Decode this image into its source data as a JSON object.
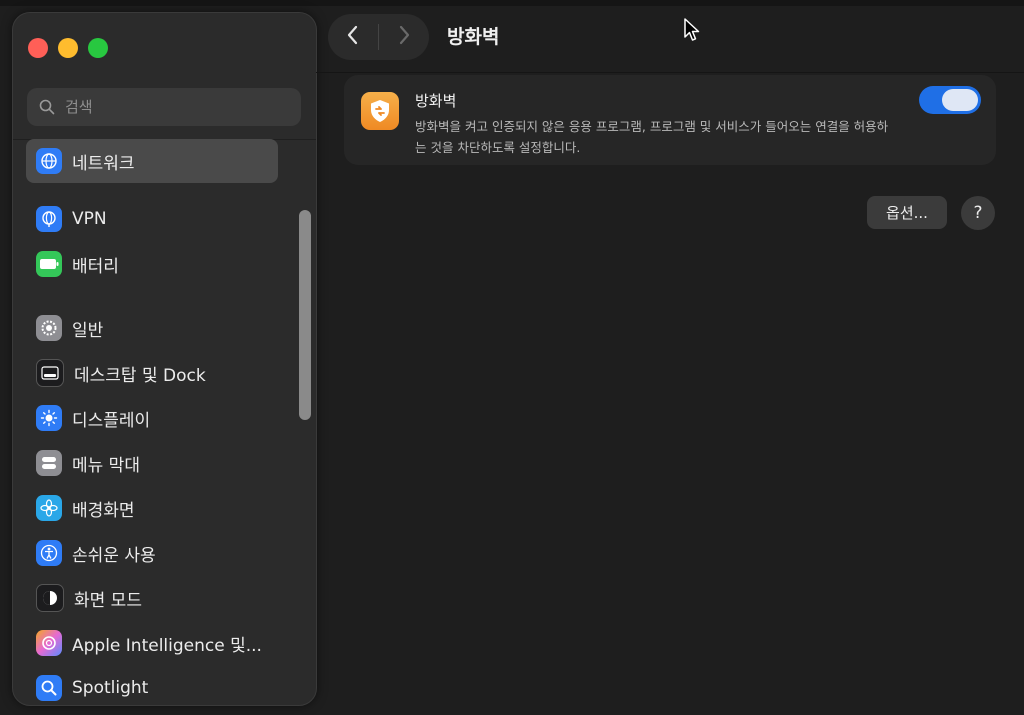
{
  "window": {
    "title": "방화벽"
  },
  "toolbar": {
    "back_icon": "chevron-left-icon",
    "forward_icon": "chevron-right-icon"
  },
  "sidebar": {
    "search_placeholder": "검색",
    "items": [
      {
        "label": "네트워크",
        "icon": "globe-icon",
        "color": "#2f7cf6",
        "active": true
      },
      {
        "label": "VPN",
        "icon": "globe-icon",
        "color": "#2f7cf6",
        "active": false
      },
      {
        "label": "배터리",
        "icon": "battery-icon",
        "color": "#34c759",
        "active": false
      },
      {
        "label": "일반",
        "icon": "gear-icon",
        "color": "#8e8e93",
        "active": false
      },
      {
        "label": "데스크탑 및 Dock",
        "icon": "dock-icon",
        "color": "#1c1c1e",
        "active": false
      },
      {
        "label": "디스플레이",
        "icon": "sun-icon",
        "color": "#2f7cf6",
        "active": false
      },
      {
        "label": "메뉴 막대",
        "icon": "menubar-icon",
        "color": "#8e8e93",
        "active": false
      },
      {
        "label": "배경화면",
        "icon": "flower-icon",
        "color": "#2aa7e8",
        "active": false
      },
      {
        "label": "손쉬운 사용",
        "icon": "accessibility-icon",
        "color": "#2f7cf6",
        "active": false
      },
      {
        "label": "화면 모드",
        "icon": "appearance-icon",
        "color": "#1c1c1e",
        "active": false
      },
      {
        "label": "Apple Intelligence 및...",
        "icon": "apple-intelligence-icon",
        "color": "#e56ad3",
        "active": false
      },
      {
        "label": "Spotlight",
        "icon": "magnifier-icon",
        "color": "#2f7cf6",
        "active": false
      }
    ]
  },
  "main": {
    "firewall": {
      "title": "방화벽",
      "description": "방화벽을 켜고 인증되지 않은 응용 프로그램, 프로그램 및 서비스가 들어오는 연결을 허용하는 것을 차단하도록 설정합니다.",
      "enabled": true
    },
    "options_label": "옵션...",
    "help_label": "?"
  }
}
